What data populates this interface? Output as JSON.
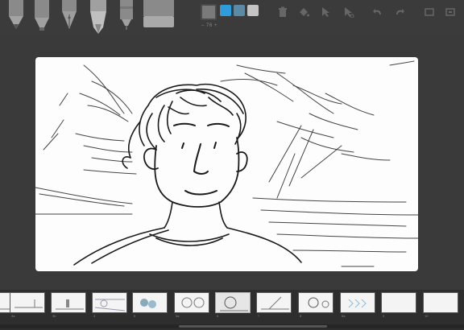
{
  "toolbar": {
    "tools": [
      {
        "name": "pencil-tool"
      },
      {
        "name": "marker-tool"
      },
      {
        "name": "ink-pen-tool"
      },
      {
        "name": "brush-tool"
      },
      {
        "name": "fine-liner-tool"
      },
      {
        "name": "eraser-tool"
      }
    ],
    "brush_size": "– 76 +",
    "colors": {
      "current": "#7a7a7a",
      "swatches": [
        "#2d9cdb",
        "#5a8aa6",
        "#c4c4c4"
      ]
    },
    "actions": [
      "trash-icon",
      "fill-bucket-icon",
      "select-icon",
      "lasso-icon",
      "undo-icon",
      "redo-icon",
      "view-icon",
      "expand-icon"
    ]
  },
  "timeline": {
    "frames": [
      {
        "label": "3"
      },
      {
        "label": "3a"
      },
      {
        "label": "3b"
      },
      {
        "label": "4"
      },
      {
        "label": "5"
      },
      {
        "label": "5a"
      },
      {
        "label": "6"
      },
      {
        "label": "7"
      },
      {
        "label": "8"
      },
      {
        "label": "8a"
      },
      {
        "label": "9"
      },
      {
        "label": "10"
      }
    ],
    "selected_index": 6
  }
}
